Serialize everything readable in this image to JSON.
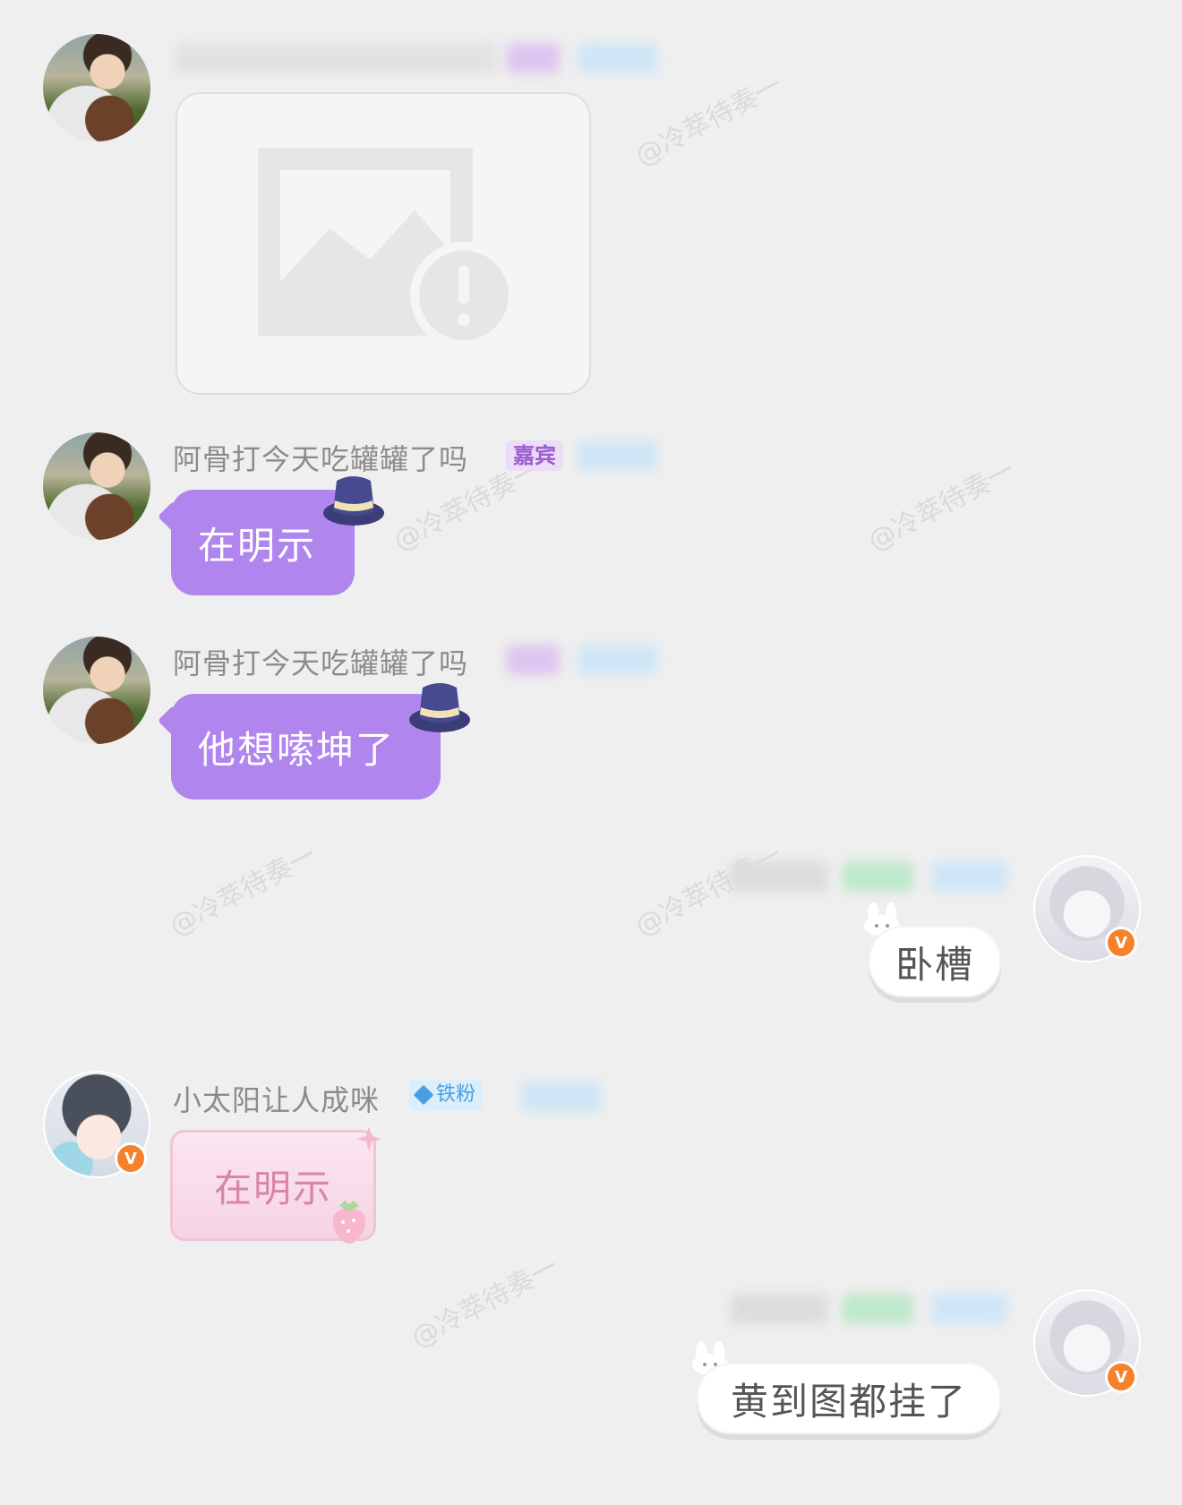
{
  "watermark": "@冷萃待奏一",
  "messages": [
    {
      "id": "m1",
      "type": "image-failed"
    },
    {
      "id": "m2",
      "sender": "阿骨打今天吃罐罐了吗",
      "tag": "嘉宾",
      "text": "在明示"
    },
    {
      "id": "m3",
      "sender": "阿骨打今天吃罐罐了吗",
      "text": "他想嗦坤了"
    },
    {
      "id": "m4",
      "text": "卧槽"
    },
    {
      "id": "m5",
      "sender": "小太阳让人成咪",
      "tag": "铁粉",
      "text": "在明示"
    },
    {
      "id": "m6",
      "text": "黄到图都挂了"
    }
  ],
  "badges": {
    "verified": "V"
  },
  "colors": {
    "background": "#efefef",
    "purple_bubble": "#b085ee",
    "verified": "#f5822a"
  }
}
